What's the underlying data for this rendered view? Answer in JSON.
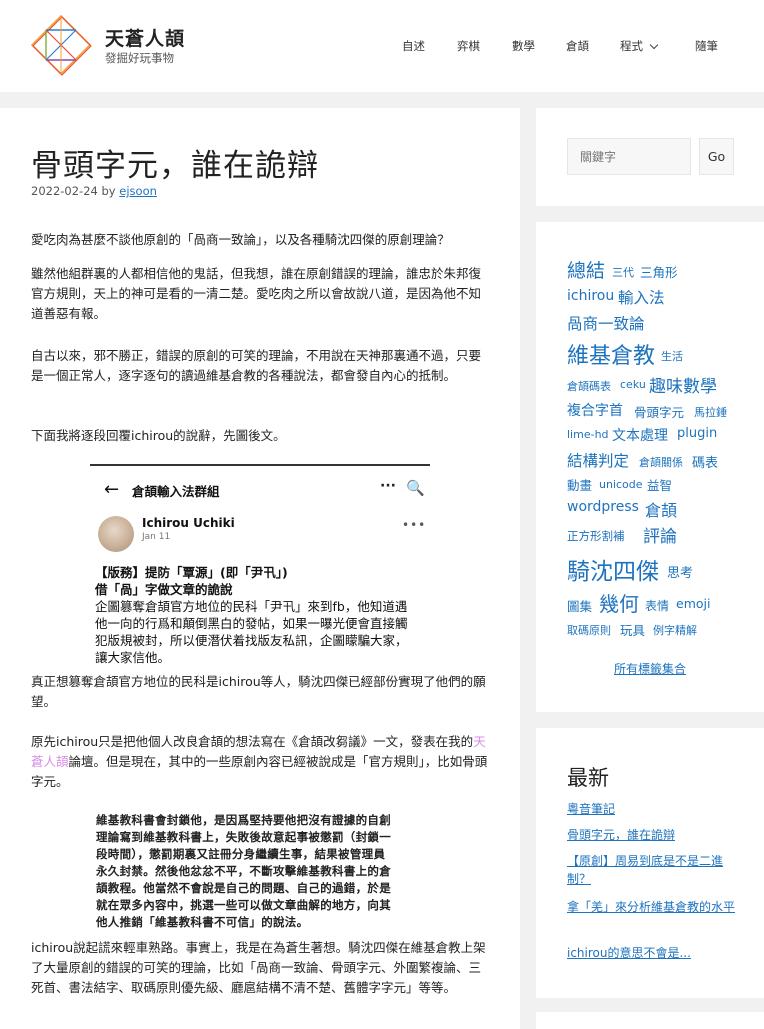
{
  "site": {
    "title": "天蒼人頡",
    "tagline": "發掘好玩事物"
  },
  "nav": {
    "items": [
      "自述",
      "弈棋",
      "數學",
      "倉頡",
      "程式",
      "隨筆"
    ]
  },
  "article": {
    "title": "骨頭字元，誰在詭辯",
    "date": "2022-02-24",
    "by": "by",
    "author": "ejsoon",
    "p1": "愛吃肉為甚麼不談他原創的「咼商一致論」，以及各種騎沈四傑的原創理論？",
    "p2": "雖然他組群裏的人都相信他的鬼話，但我想，誰在原創錯誤的理論，誰忠於朱邦復官方規則，天上的神可是看的一清二楚。愛吃肉之所以會故說八道，是因為他不知道善惡有報。",
    "p3": "自古以來，邪不勝正，錯誤的原創的可笑的理論，不用說在天神那裏通不過，只要是一個正常人，逐字逐句的讀過維基倉教的各種說法，都會發自內心的抵制。",
    "p4": "下面我將逐段回覆ichirou的說辭，先圖後文。",
    "p5": "真正想篡奪倉頡官方地位的民科是ichirou等人，騎沈四傑已經部份實現了他們的願望。",
    "p6_a": "原先ichirou只是把他個人改良倉頡的想法寫在《倉頡改芻議》一文，發表在我的",
    "p6_link": "天蒼人頡",
    "p6_b": "論壇。但是現在，其中的一些原創內容已經被說成是「官方規則」，比如骨頭字元。",
    "p7": "ichirou說起謊來輕車熟路。事實上，我是在為蒼生著想。騎沈四傑在維基倉教上架了大量原創的錯誤的可笑的理論，比如「咼商一致論、骨頭字元、外圍繁複論、三死首、書法結字、取碼原則優先級、廳扈結構不清不楚、舊體字字元」等等。"
  },
  "fb_post": {
    "back": "←",
    "group": "倉頡輸入法群組",
    "more": "···",
    "search": "🔍",
    "name": "Ichirou Uchiki",
    "date": "Jan 11",
    "more2": "•••",
    "line1": "【版務】提防「覃源」(即「尹卂」)",
    "line2": "借「咼」字做文章的詭說",
    "line3": "企圖篡奪倉頡官方地位的民科「尹卂」來到fb，他知道遇",
    "line4": "他一向的行爲和顛倒黑白的發帖，如果一曝光便會直接觸",
    "line5": "犯版規被封，所以便潛伏着找版友私訊，企圖矇騙大家，",
    "line6": "讓大家信他。"
  },
  "quote_img": {
    "lines": [
      "維基教科書會封鎖他，是因爲堅持要他把沒有證據的自創",
      "理論寫到維基教科書上，失敗後故意起事被懲罰（封鎖一",
      "段時間），懲罰期裏又註冊分身繼續生事，結果被管理員",
      "永久封禁。然後他忿忿不平，不斷攻擊維基教科書上的倉",
      "頡教程。他當然不會說是自己的問題、自己的過錯，於是",
      "就在眾多內容中，挑選一些可以做文章曲解的地方，向其",
      "他人推銷「維基教科書不可信」的說法。"
    ]
  },
  "sidebar": {
    "search_placeholder": "關鍵字",
    "search_button": "Go",
    "tags": [
      "總結",
      "三代",
      "三角形",
      "ichirou",
      "輸入法",
      "咼商一致論",
      "維基倉教",
      "生活",
      "倉頡碼表",
      "ceku",
      "趣味數學",
      "複合字首",
      "骨頭字元",
      "馬拉錘",
      "lime-hd",
      "文本處理",
      "plugin",
      "結構判定",
      "倉頡關係",
      "碼表",
      "動畫",
      "unicode",
      "益智",
      "wordpress",
      "倉頡",
      "正方形割補",
      "評論",
      "騎沈四傑",
      "思考",
      "圖集",
      "幾何",
      "表情",
      "emoji",
      "取碼原則",
      "玩具",
      "例字精解"
    ],
    "all_tags": "所有標籤集合",
    "recent_title": "最新",
    "recent": [
      "粵音筆記",
      "骨頭字元，誰在詭辯",
      "【原創】周易到底是不是二進制？",
      "拿「羌」來分析維基倉教的水平",
      "ichirou的意思不會是..."
    ]
  },
  "colors": {
    "link": "#1e73be",
    "highlight": "#d88ee8",
    "background": "#f1f1f1"
  }
}
